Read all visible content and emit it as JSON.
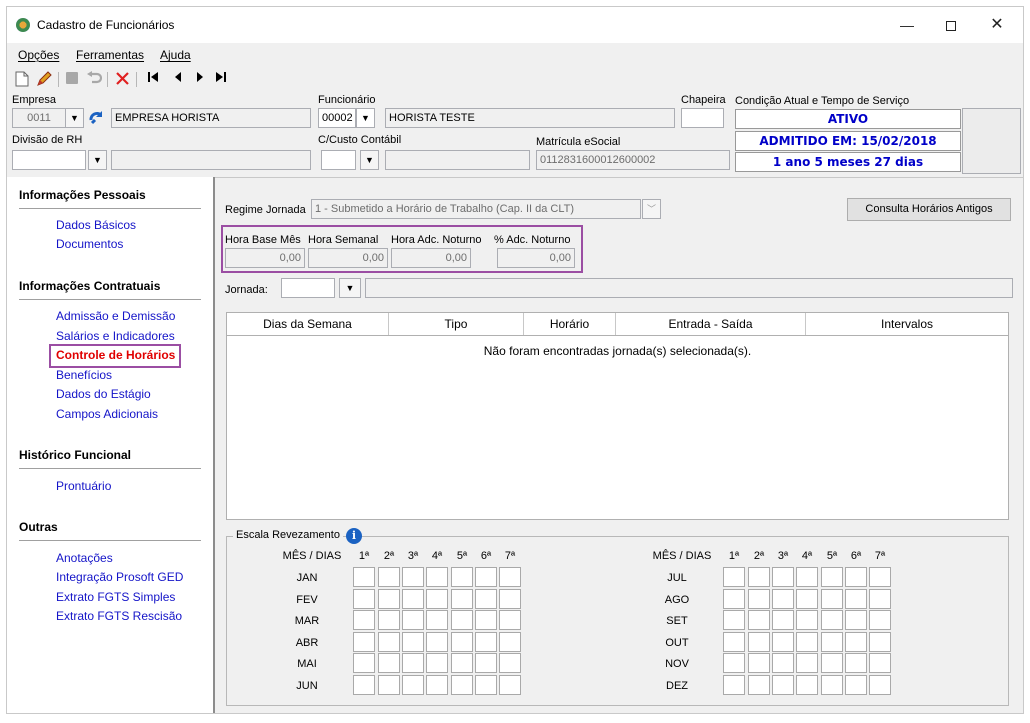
{
  "window": {
    "title": "Cadastro de Funcionários",
    "minimize": "—",
    "close": "✕"
  },
  "menu": [
    "Opções",
    "Ferramentas",
    "Ajuda"
  ],
  "toolbar_icons": [
    "new-document-icon",
    "edit-pencil-icon",
    "save-icon",
    "undo-icon",
    "delete-x-icon",
    "first-record-icon",
    "previous-record-icon",
    "next-record-icon",
    "last-record-icon"
  ],
  "header": {
    "empresa_label": "Empresa",
    "empresa_code": "0011",
    "empresa_name": "EMPRESA HORISTA",
    "funcionario_label": "Funcionário",
    "funcionario_code": "00002",
    "funcionario_name": "HORISTA TESTE",
    "chapeira_label": "Chapeira",
    "chapeira_value": "",
    "condicao_label": "Condição Atual e Tempo de Serviço",
    "status": "ATIVO",
    "admitido": "ADMITIDO EM: 15/02/2018",
    "tempo": "1 ano 5 meses 27 dias",
    "divisao_label": "Divisão de RH",
    "divisao_value": "",
    "ccusto_label": "C/Custo Contábil",
    "ccusto_value": "",
    "matricula_label": "Matrícula eSocial",
    "matricula_value": "0112831600012600002"
  },
  "nav": {
    "sections": [
      {
        "title": "Informações Pessoais",
        "items": [
          "Dados Básicos",
          "Documentos"
        ]
      },
      {
        "title": "Informações Contratuais",
        "items": [
          "Admissão e Demissão",
          "Salários e Indicadores",
          "Controle de Horários",
          "Benefícios",
          "Dados do Estágio",
          "Campos Adicionais"
        ]
      },
      {
        "title": "Histórico Funcional",
        "items": [
          "Prontuário"
        ]
      },
      {
        "title": "Outras",
        "items": [
          "Anotações",
          "Integração Prosoft GED",
          "Extrato FGTS Simples",
          "Extrato FGTS Rescisão"
        ]
      }
    ],
    "active": "Controle de Horários"
  },
  "main": {
    "regime_label": "Regime Jornada",
    "regime_value": "1 - Submetido a Horário de Trabalho (Cap. II da CLT)",
    "consulta_button": "Consulta Horários Antigos",
    "hour_fields": [
      {
        "label": "Hora Base Mês",
        "value": "0,00"
      },
      {
        "label": "Hora Semanal",
        "value": "0,00"
      },
      {
        "label": "Hora Adc. Noturno",
        "value": "0,00"
      },
      {
        "label": "% Adc. Noturno",
        "value": "0,00"
      }
    ],
    "jornada_label": "Jornada:",
    "jornada_value": "",
    "grid_columns": [
      "Dias da Semana",
      "Tipo",
      "Horário",
      "Entrada - Saída",
      "Intervalos"
    ],
    "grid_empty": "Não foram encontradas jornada(s) selecionada(s).",
    "escala": {
      "title": "Escala Revezamento",
      "header_label": "MÊS / DIAS",
      "weeks": [
        "1ª",
        "2ª",
        "3ª",
        "4ª",
        "5ª",
        "6ª",
        "7ª"
      ],
      "months_left": [
        "JAN",
        "FEV",
        "MAR",
        "ABR",
        "MAI",
        "JUN"
      ],
      "months_right": [
        "JUL",
        "AGO",
        "SET",
        "OUT",
        "NOV",
        "DEZ"
      ]
    }
  },
  "colors": {
    "link": "#1414c8",
    "active_link": "#e00000",
    "highlight": "#9b4ea3",
    "status_text": "#0000c8"
  }
}
